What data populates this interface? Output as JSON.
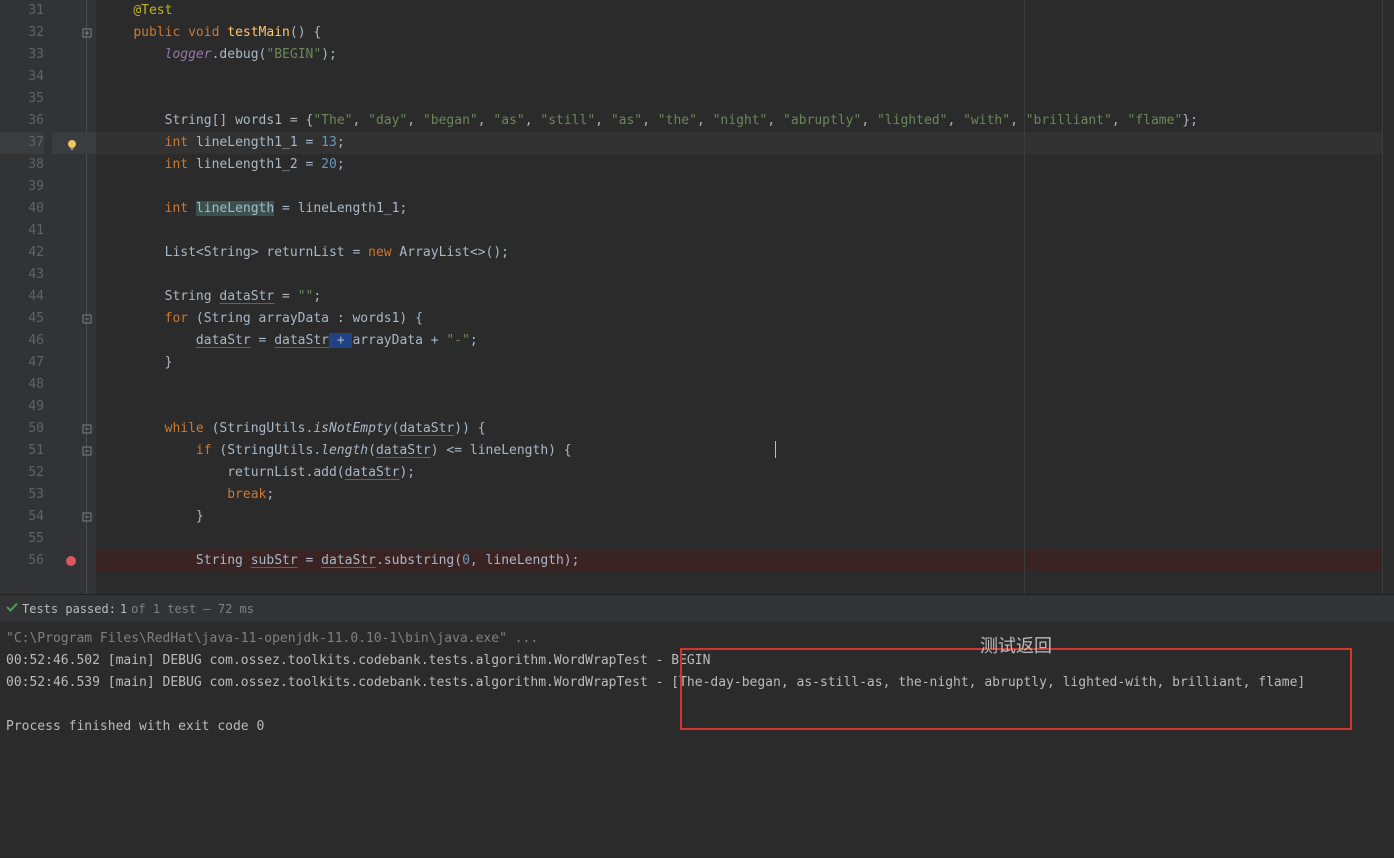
{
  "editor": {
    "line_start": 31,
    "line_end": 56,
    "current_line": 37,
    "breakpoint_line": 56,
    "fold_lines": [
      45,
      50,
      51,
      54
    ],
    "open_fold_lines": [
      32
    ],
    "code": {
      "l31": {
        "anno": "@Test"
      },
      "l32": {
        "kw1": "public",
        "kw2": "void",
        "fn": "testMain",
        "open": "() {"
      },
      "l33": {
        "logger": "logger",
        "dot": ".debug(",
        "s": "\"BEGIN\"",
        "close": ");"
      },
      "l36": {
        "string_type": "String[] ",
        "var": "words1",
        "eq": " = {",
        "items": [
          "\"The\"",
          "\"day\"",
          "\"began\"",
          "\"as\"",
          "\"still\"",
          "\"as\"",
          "\"the\"",
          "\"night\"",
          "\"abruptly\"",
          "\"lighted\"",
          "\"with\"",
          "\"brilliant\"",
          "\"flame\""
        ],
        "end": "};"
      },
      "l37": {
        "kw": "int",
        "var": "lineLength1_1",
        "eq": " = ",
        "num": "13",
        "semi": ";"
      },
      "l38": {
        "kw": "int",
        "var": "lineLength1_2",
        "eq": " = ",
        "num": "20",
        "semi": ";"
      },
      "l40": {
        "kw": "int",
        "var": "lineLength",
        "eq": " = lineLength1_1;"
      },
      "l42": {
        "text": "List<String> returnList = ",
        "kw": "new",
        "ctor": " ArrayList<>();"
      },
      "l44": {
        "pre": "String ",
        "v": "dataStr",
        "eq": " = ",
        "s": "\"\"",
        "semi": ";"
      },
      "l45": {
        "kw": "for",
        "open": " (String arrayData : words1) {"
      },
      "l46": {
        "v1": "dataStr",
        "eq": " = ",
        "v2": "dataStr",
        "plus": " + ",
        "rest": "arrayData + ",
        "s": "\"-\"",
        "semi": ";"
      },
      "l47": {
        "brace": "}"
      },
      "l50": {
        "kw": "while",
        "open": " (StringUtils.",
        "fn": "isNotEmpty",
        "p": "(",
        "v": "dataStr",
        "close": ")) {"
      },
      "l51": {
        "kw": "if",
        "open": " (StringUtils.",
        "fn": "length",
        "p": "(",
        "v": "dataStr",
        "close": ") <= lineLength) {"
      },
      "l52": {
        "text": "returnList.add(",
        "v": "dataStr",
        "close": ");"
      },
      "l53": {
        "kw": "break",
        "semi": ";"
      },
      "l54": {
        "brace": "}"
      },
      "l56": {
        "pre": "String ",
        "v": "subStr",
        "eq": " = ",
        "v2": "dataStr",
        "rest": ".substring(",
        "num": "0",
        "close": ", lineLength);"
      }
    }
  },
  "status": {
    "passed_label": "Tests passed:",
    "passed_count": "1",
    "of_text": "of 1 test – 72 ms"
  },
  "console": {
    "cmd": "\"C:\\Program Files\\RedHat\\java-11-openjdk-11.0.10-1\\bin\\java.exe\" ...",
    "l1": "00:52:46.502 [main] DEBUG com.ossez.toolkits.codebank.tests.algorithm.WordWrapTest - BEGIN",
    "l2": "00:52:46.539 [main] DEBUG com.ossez.toolkits.codebank.tests.algorithm.WordWrapTest - [The-day-began, as-still-as, the-night, abruptly, lighted-with, brilliant, flame]",
    "exit": "Process finished with exit code 0"
  },
  "annotation": {
    "label": "测试返回"
  }
}
